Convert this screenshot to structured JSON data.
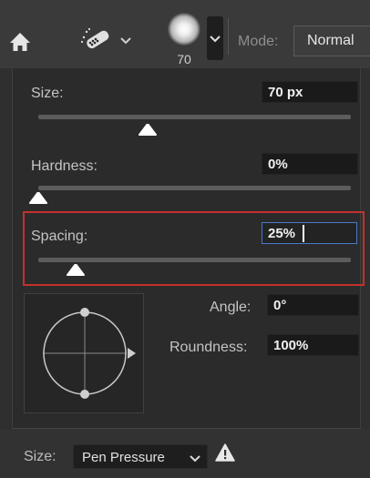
{
  "options_bar": {
    "home_icon": "home-icon",
    "tool_icon": "brush-tool-icon",
    "brush_size": "70",
    "mode_label": "Mode:",
    "mode_value": "Normal"
  },
  "panel": {
    "size": {
      "label": "Size:",
      "value": "70 px",
      "slider_fraction": 0.35
    },
    "hardness": {
      "label": "Hardness:",
      "value": "0%",
      "slider_fraction": 0.0
    },
    "spacing": {
      "label": "Spacing:",
      "value": "25%",
      "slider_fraction": 0.12
    },
    "angle": {
      "label": "Angle:",
      "value": "0°"
    },
    "roundness": {
      "label": "Roundness:",
      "value": "100%"
    }
  },
  "bottom_bar": {
    "size_label": "Size:",
    "pen_pressure": "Pen Pressure",
    "warning_icon": "warning-icon"
  },
  "colors": {
    "highlight": "#c4322c",
    "active_field_border": "#4b78c8"
  }
}
